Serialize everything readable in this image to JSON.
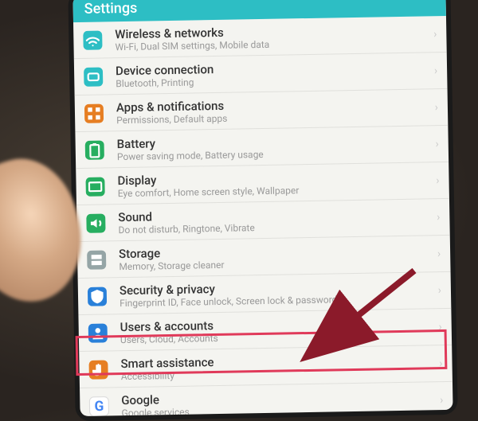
{
  "header": {
    "title": "Settings"
  },
  "rows": [
    {
      "icon": "wifi-icon",
      "bg": "#2dbec4",
      "title": "Wireless & networks",
      "sub": "Wi-Fi, Dual SIM settings, Mobile data"
    },
    {
      "icon": "link-icon",
      "bg": "#2dbec4",
      "title": "Device connection",
      "sub": "Bluetooth, Printing"
    },
    {
      "icon": "grid-icon",
      "bg": "#e67e22",
      "title": "Apps & notifications",
      "sub": "Permissions, Default apps"
    },
    {
      "icon": "battery-icon",
      "bg": "#27ae60",
      "title": "Battery",
      "sub": "Power saving mode, Battery usage"
    },
    {
      "icon": "display-icon",
      "bg": "#27ae60",
      "title": "Display",
      "sub": "Eye comfort, Home screen style, Wallpaper"
    },
    {
      "icon": "sound-icon",
      "bg": "#27ae60",
      "title": "Sound",
      "sub": "Do not disturb, Ringtone, Vibrate"
    },
    {
      "icon": "storage-icon",
      "bg": "#95a5a6",
      "title": "Storage",
      "sub": "Memory, Storage cleaner"
    },
    {
      "icon": "shield-icon",
      "bg": "#2980d9",
      "title": "Security & privacy",
      "sub": "Fingerprint ID, Face unlock, Screen lock & passwords"
    },
    {
      "icon": "users-icon",
      "bg": "#2980d9",
      "title": "Users & accounts",
      "sub": "Users, Cloud, Accounts"
    },
    {
      "icon": "hand-icon",
      "bg": "#e67e22",
      "title": "Smart assistance",
      "sub": "Accessibility"
    },
    {
      "icon": "google-icon",
      "bg": "#ffffff",
      "title": "Google",
      "sub": "Google services"
    }
  ],
  "chevron": "›"
}
